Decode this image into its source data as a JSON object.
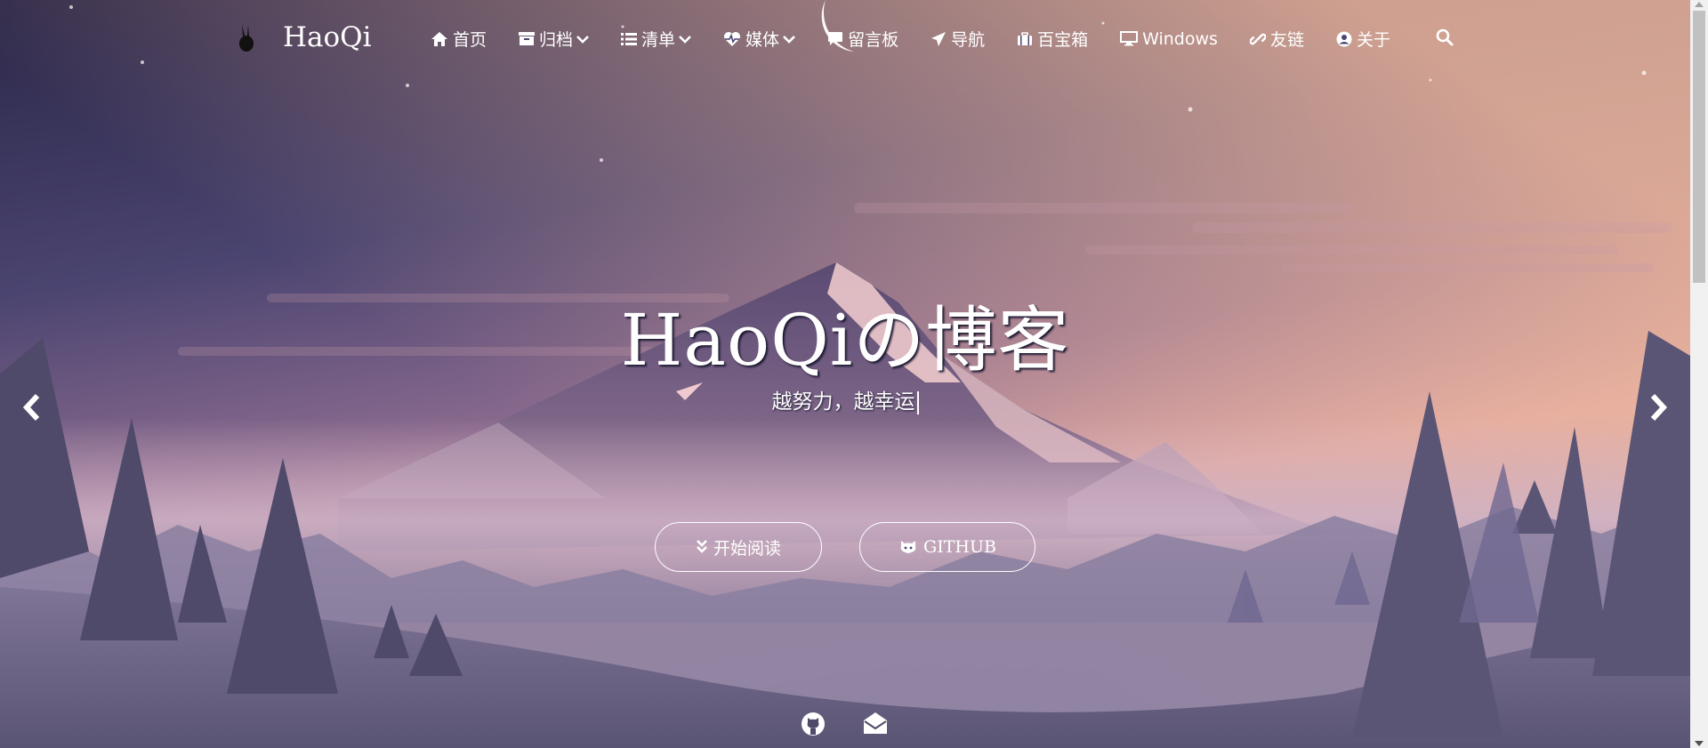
{
  "site": {
    "brand": "HaoQi"
  },
  "nav": {
    "items": [
      {
        "label": "首页",
        "icon": "home-icon",
        "dropdown": false
      },
      {
        "label": "归档",
        "icon": "archive-icon",
        "dropdown": true
      },
      {
        "label": "清单",
        "icon": "list-icon",
        "dropdown": true
      },
      {
        "label": "媒体",
        "icon": "heartbeat-icon",
        "dropdown": true
      },
      {
        "label": "留言板",
        "icon": "comment-icon",
        "dropdown": false
      },
      {
        "label": "导航",
        "icon": "paper-plane-icon",
        "dropdown": false
      },
      {
        "label": "百宝箱",
        "icon": "suitcase-icon",
        "dropdown": false
      },
      {
        "label": "Windows",
        "icon": "desktop-icon",
        "dropdown": false
      },
      {
        "label": "友链",
        "icon": "link-icon",
        "dropdown": false
      },
      {
        "label": "关于",
        "icon": "user-circle-icon",
        "dropdown": false
      }
    ],
    "search_icon": "search-icon"
  },
  "hero": {
    "title": "HaoQiの博客",
    "subtitle": "越努力，越幸运",
    "read_button": "开始阅读",
    "github_button": "GITHUB"
  },
  "colors": {
    "sky_top": "#2e2a4f",
    "sky_mid": "#6b5a86",
    "horizon": "#e9b4a8",
    "mountain": "#8a6c8e",
    "trees_dark": "#3c3957"
  }
}
